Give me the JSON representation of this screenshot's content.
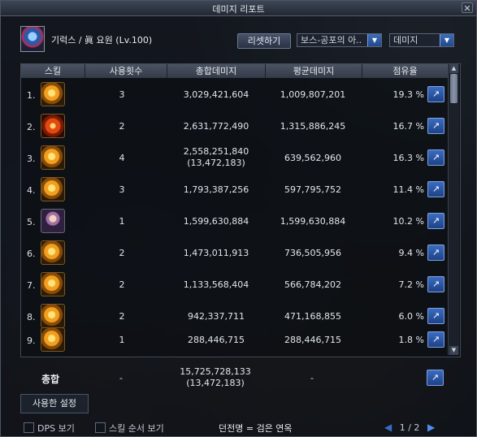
{
  "window": {
    "title": "데미지 리포트",
    "close_label": "✕"
  },
  "player": {
    "name": "기럭스 / 眞 요원 (Lv.100)"
  },
  "toolbar": {
    "reset_label": "리셋하기",
    "dungeon_select": "보스-공포의 아..",
    "metric_select": "데미지"
  },
  "table": {
    "headers": [
      "스킬",
      "사용횟수",
      "총합데미지",
      "평균데미지",
      "점유율"
    ],
    "rows": [
      {
        "num": "1.",
        "icon": "fire-kanji-skill-icon",
        "uses": "3",
        "total": "3,029,421,604",
        "total_sub": "",
        "avg": "1,009,807,201",
        "share": "19.3 %"
      },
      {
        "num": "2.",
        "icon": "red-slash-skill-icon",
        "uses": "2",
        "total": "2,631,772,490",
        "total_sub": "",
        "avg": "1,315,886,245",
        "share": "16.7 %"
      },
      {
        "num": "3.",
        "icon": "sword-skill-icon",
        "uses": "4",
        "total": "2,558,251,840",
        "total_sub": "(13,472,183)",
        "avg": "639,562,960",
        "share": "16.3 %"
      },
      {
        "num": "4.",
        "icon": "double-blade-skill-icon",
        "uses": "3",
        "total": "1,793,387,256",
        "total_sub": "",
        "avg": "597,795,752",
        "share": "11.4 %"
      },
      {
        "num": "5.",
        "icon": "character-skill-icon",
        "uses": "1",
        "total": "1,599,630,884",
        "total_sub": "",
        "avg": "1,599,630,884",
        "share": "10.2 %"
      },
      {
        "num": "6.",
        "icon": "whirl-skill-icon",
        "uses": "2",
        "total": "1,473,011,913",
        "total_sub": "",
        "avg": "736,505,956",
        "share": "9.4 %"
      },
      {
        "num": "7.",
        "icon": "bow-skill-icon",
        "uses": "2",
        "total": "1,133,568,404",
        "total_sub": "",
        "avg": "566,784,202",
        "share": "7.2 %"
      },
      {
        "num": "8.",
        "icon": "burst-skill-icon",
        "uses": "2",
        "total": "942,337,711",
        "total_sub": "",
        "avg": "471,168,855",
        "share": "6.0 %"
      },
      {
        "num": "9.",
        "icon": "wheel-skill-icon",
        "uses": "1",
        "total": "288,446,715",
        "total_sub": "",
        "avg": "288,446,715",
        "share": "1.8 %"
      }
    ]
  },
  "total_row": {
    "label": "총합",
    "uses": "-",
    "total": "15,725,728,133",
    "total_sub": "(13,472,183)",
    "avg": "-"
  },
  "footer": {
    "settings_tab": "사용한 설정",
    "dps_label": "DPS 보기",
    "skill_order_label": "스킬 순서 보기",
    "status_text": "던전명 = 검은 연옥",
    "page": "1 / 2"
  }
}
